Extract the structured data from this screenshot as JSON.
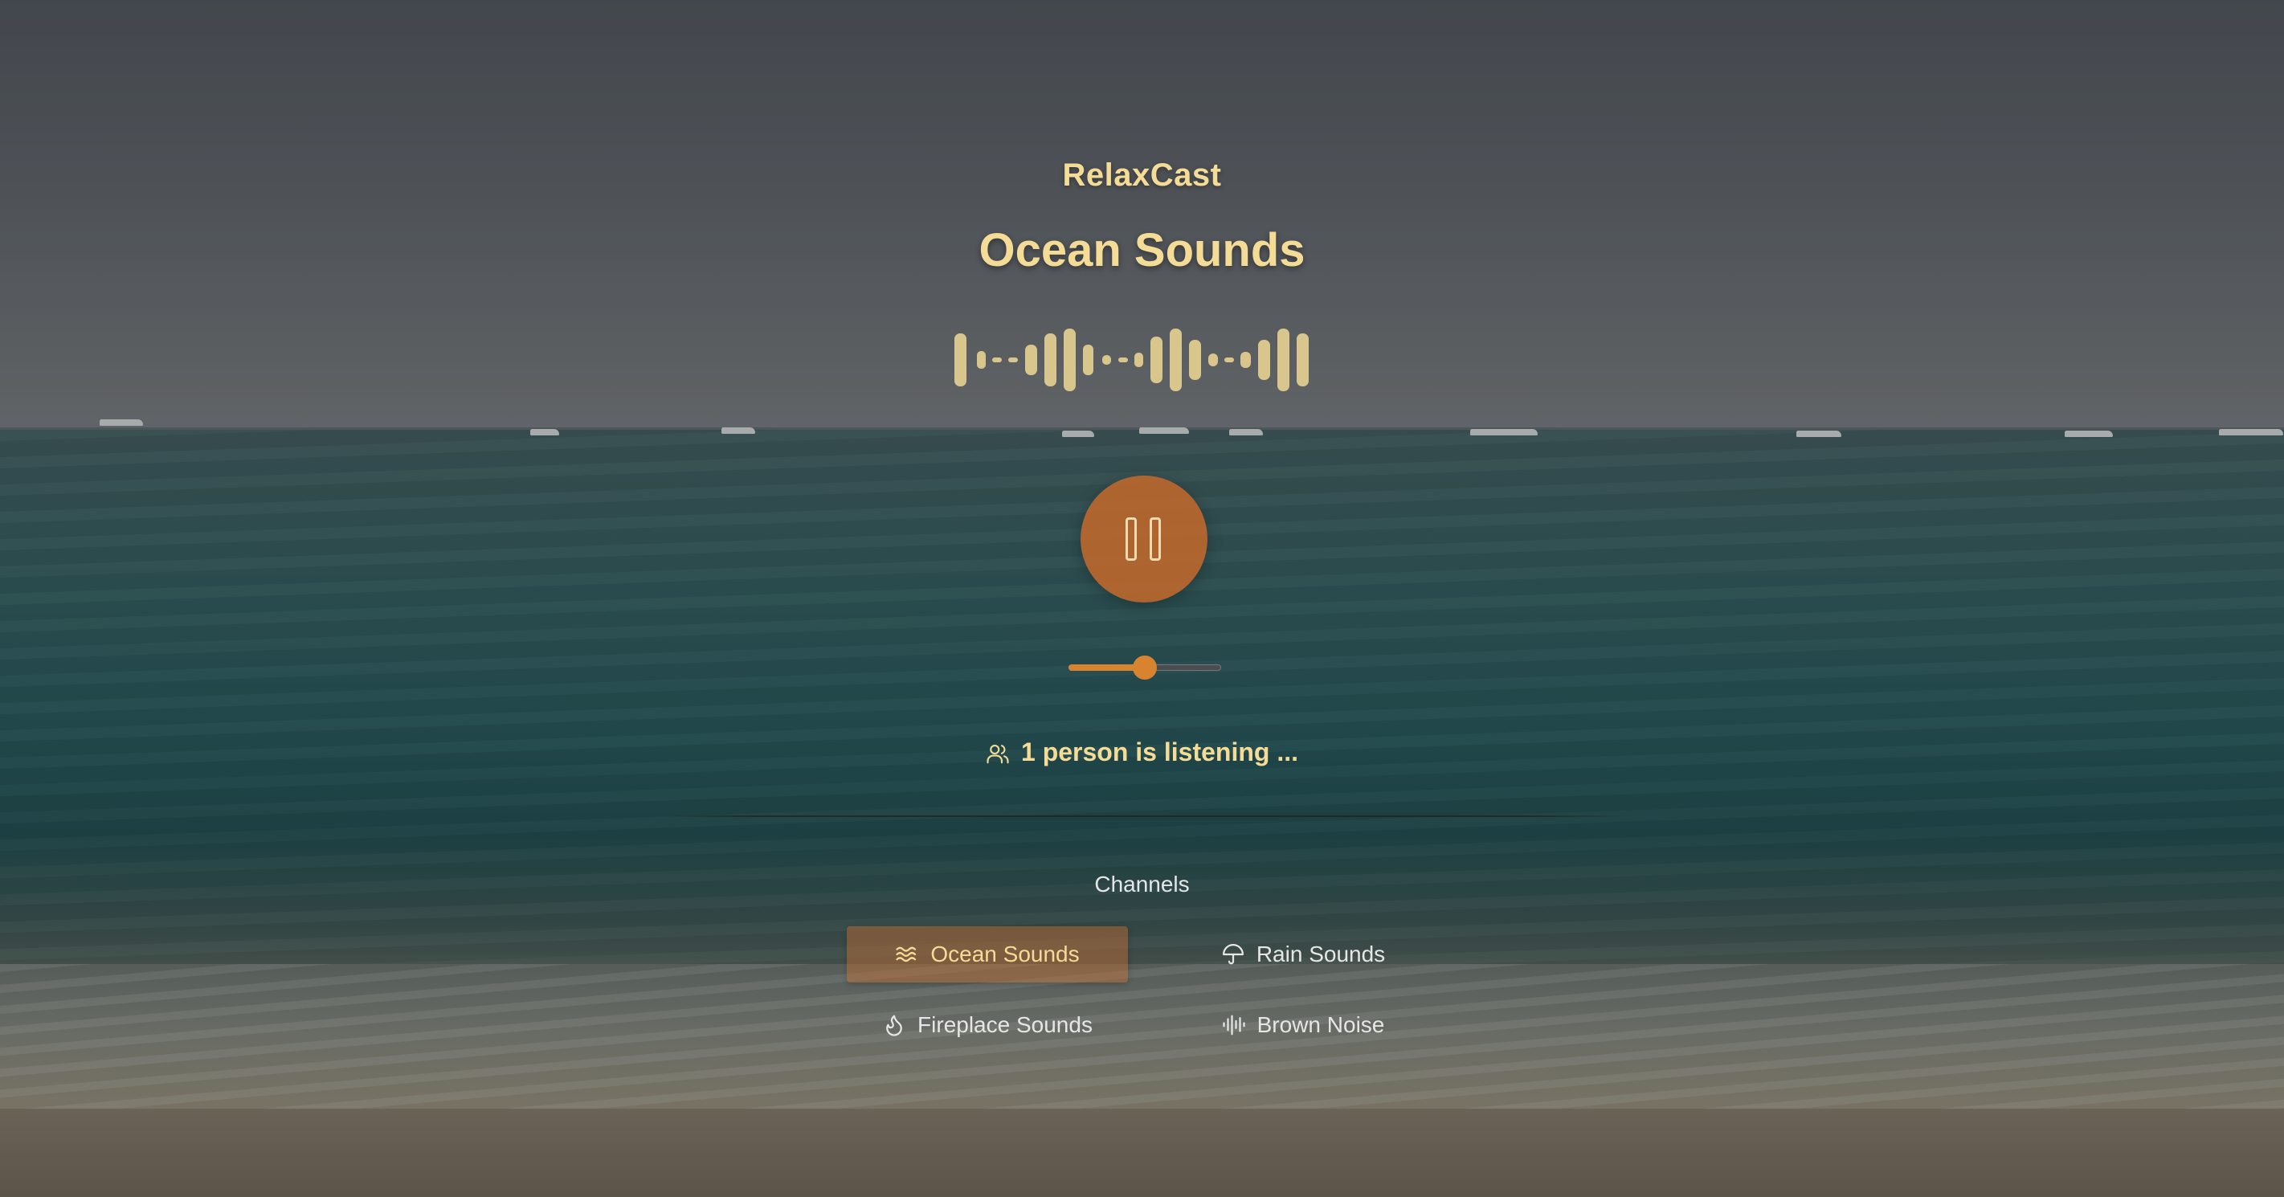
{
  "app": {
    "name": "RelaxCast"
  },
  "player": {
    "title": "Ocean Sounds",
    "state": "playing",
    "control_icon": "pause-icon",
    "volume": 0.5,
    "listeners_text": "1 person is listening ...",
    "listeners_icon": "users-icon"
  },
  "channels": {
    "heading": "Channels",
    "items": [
      {
        "label": "Ocean Sounds",
        "icon": "waves-icon",
        "active": true
      },
      {
        "label": "Rain Sounds",
        "icon": "umbrella-icon",
        "active": false
      },
      {
        "label": "Fireplace Sounds",
        "icon": "flame-icon",
        "active": false
      },
      {
        "label": "Brown Noise",
        "icon": "audio-lines-icon",
        "active": false
      }
    ]
  },
  "colors": {
    "accent": "#d8832f",
    "title": "#f4dc96",
    "muted_text": "#e6e6e6"
  }
}
